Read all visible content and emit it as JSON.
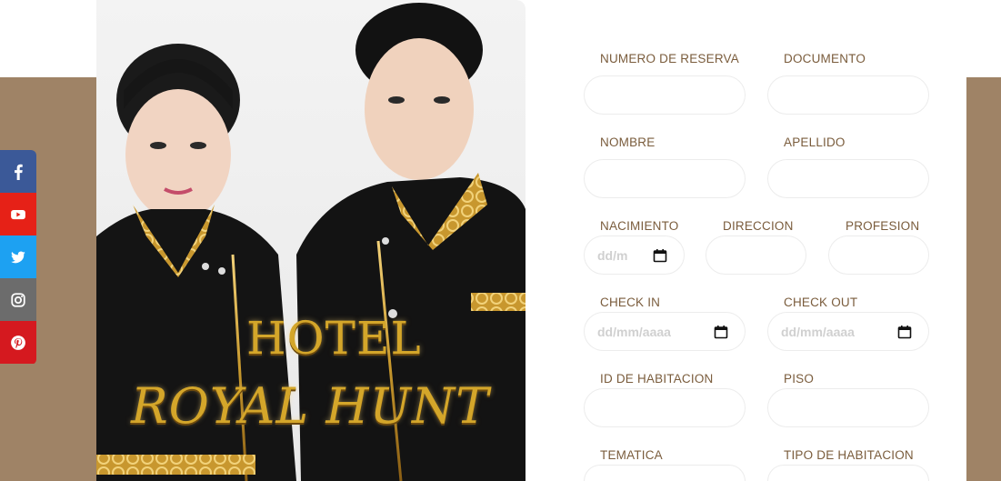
{
  "colors": {
    "background_band": "#9f8366",
    "label": "#7a5c3c",
    "facebook": "#3b5998",
    "youtube": "#e62117",
    "twitter": "#1da1f2",
    "instagram": "#6c6c6c",
    "pinterest": "#d5191f",
    "gold": "#d4a62a"
  },
  "social": {
    "items": [
      {
        "name": "facebook-icon"
      },
      {
        "name": "youtube-icon"
      },
      {
        "name": "twitter-icon"
      },
      {
        "name": "instagram-icon"
      },
      {
        "name": "pinterest-icon"
      }
    ]
  },
  "hero": {
    "title_line1": "HOTEL",
    "title_line2": "ROYAL HUNT"
  },
  "form": {
    "numero_reserva_label": "NUMERO DE RESERVA",
    "documento_label": "DOCUMENTO",
    "nombre_label": "NOMBRE",
    "apellido_label": "APELLIDO",
    "nacimiento_label": "NACIMIENTO",
    "nacimiento_value": "dd/m",
    "direccion_label": "DIRECCION",
    "profesion_label": "PROFESION",
    "check_in_label": "CHECK IN",
    "check_in_value": "dd/mm/aaaa",
    "check_out_label": "CHECK OUT",
    "check_out_value": "dd/mm/aaaa",
    "id_habitacion_label": "ID DE HABITACION",
    "piso_label": "PISO",
    "tematica_label": "TEMATICA",
    "tipo_habitacion_label": "TIPO DE HABITACION"
  }
}
